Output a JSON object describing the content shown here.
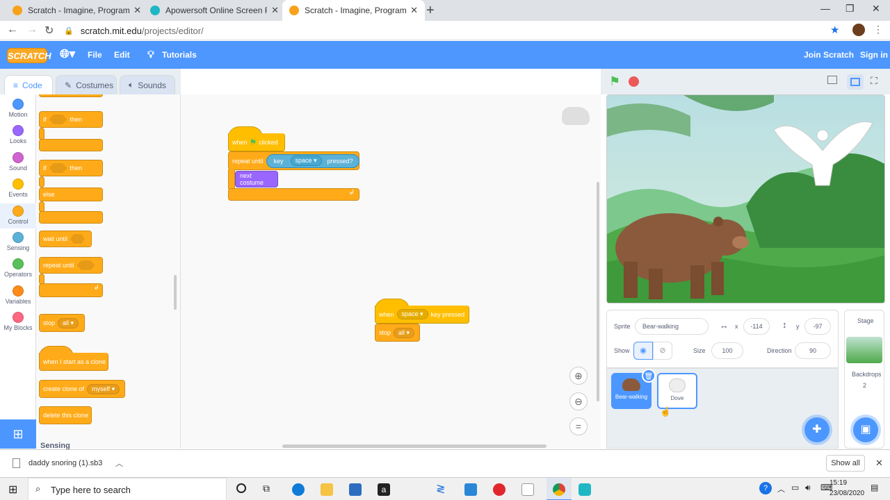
{
  "browser": {
    "tabs": [
      {
        "title": "Scratch - Imagine, Program, Shar",
        "color": "#f7a21b"
      },
      {
        "title": "Apowersoft Online Screen Recor",
        "color": "#1fb7c4"
      },
      {
        "title": "Scratch - Imagine, Program, Shar",
        "color": "#f7a21b"
      }
    ],
    "url_host": "scratch.mit.edu",
    "url_path": "/projects/editor/"
  },
  "menubar": {
    "logo": "SCRATCH",
    "file": "File",
    "edit": "Edit",
    "tutorials": "Tutorials",
    "join": "Join Scratch",
    "signin": "Sign in"
  },
  "editor_tabs": {
    "code": "Code",
    "costumes": "Costumes",
    "sounds": "Sounds"
  },
  "categories": [
    {
      "label": "Motion",
      "color": "#4c97ff"
    },
    {
      "label": "Looks",
      "color": "#9966ff"
    },
    {
      "label": "Sound",
      "color": "#cf63cf"
    },
    {
      "label": "Events",
      "color": "#ffbf00"
    },
    {
      "label": "Control",
      "color": "#ffab19"
    },
    {
      "label": "Sensing",
      "color": "#5cb1d6"
    },
    {
      "label": "Operators",
      "color": "#59c059"
    },
    {
      "label": "Variables",
      "color": "#ff8c1a"
    },
    {
      "label": "My Blocks",
      "color": "#ff6680"
    }
  ],
  "palette": {
    "if1": "if",
    "then1": "then",
    "if2": "if",
    "then2": "then",
    "else": "else",
    "wait_until": "wait until",
    "repeat_until": "repeat until",
    "stop": "stop",
    "stop_opt": "all",
    "start_clone": "when I start as a clone",
    "create_clone": "create clone of",
    "create_opt": "myself",
    "delete_clone": "delete this clone",
    "sensing": "Sensing"
  },
  "script1": {
    "when": "when",
    "clicked": "clicked",
    "repeat_until": "repeat until",
    "key": "key",
    "key_opt": "space",
    "pressed": "pressed?",
    "next_costume": "next costume"
  },
  "script2": {
    "when": "when",
    "key_opt": "space",
    "key_pressed": "key pressed",
    "stop": "stop",
    "stop_opt": "all"
  },
  "sprite_info": {
    "sprite_label": "Sprite",
    "sprite_name": "Bear-walking",
    "x_label": "x",
    "x": "-114",
    "y_label": "y",
    "y": "-97",
    "show_label": "Show",
    "size_label": "Size",
    "size": "100",
    "direction_label": "Direction",
    "direction": "90"
  },
  "sprites": [
    {
      "name": "Bear-walking"
    },
    {
      "name": "Dove"
    }
  ],
  "stage_panel": {
    "title": "Stage",
    "backdrops_label": "Backdrops",
    "backdrops_count": "2"
  },
  "download": {
    "file": "daddy snoring (1).sb3",
    "show_all": "Show all"
  },
  "taskbar": {
    "search": "Type here to search",
    "time": "15:19",
    "date": "23/08/2020"
  }
}
